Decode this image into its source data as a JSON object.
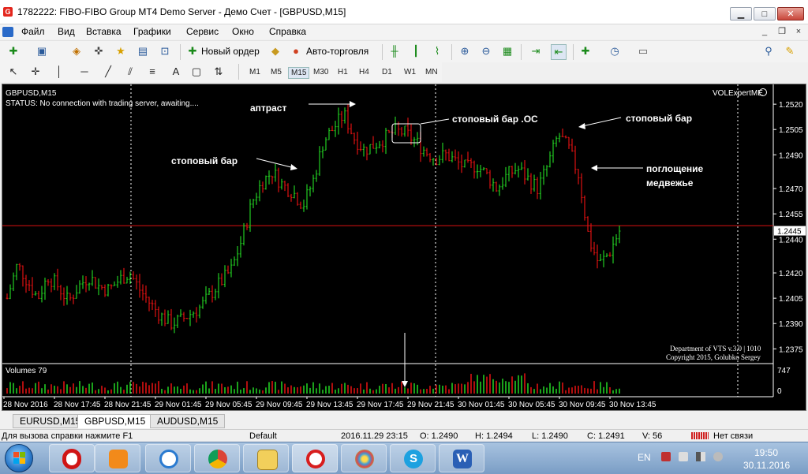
{
  "window": {
    "title": "1782222: FIBO-FIBO Group MT4 Demo Server - Демо Счет - [GBPUSD,M15]",
    "logo_letter": "G",
    "minimize": "▁",
    "maximize": "□",
    "close": "✕"
  },
  "menu": [
    "Файл",
    "Вид",
    "Вставка",
    "Графики",
    "Сервис",
    "Окно",
    "Справка"
  ],
  "toolbar": {
    "new_order": "Новый ордер",
    "auto_trading": "Авто-торговля"
  },
  "timeframes": [
    "M1",
    "M5",
    "M15",
    "M30",
    "H1",
    "H4",
    "D1",
    "W1",
    "MN"
  ],
  "active_timeframe": "M15",
  "chart": {
    "header": "GBPUSD,M15",
    "status": "STATUS:   No connection with trading server, awaiting....",
    "ea_label": "VOLExpertME",
    "copyright_line1": "Department of VTS  v.3.0 | 1010",
    "copyright_line2": "Copyright 2015, Golubko Sergey",
    "volumes_label": "Volumes 79",
    "current_price": "1.2445",
    "colors": {
      "bull": "#22cc22",
      "bear": "#dd1111",
      "background": "#000000",
      "grid": "#ffffff",
      "price_line": "#dd1111"
    },
    "annotations": [
      {
        "text": "аптраст"
      },
      {
        "text": "стоповый бар .OC"
      },
      {
        "text": "стоповый бар"
      },
      {
        "text": "стоповый бар"
      },
      {
        "text": "поглощение"
      },
      {
        "text": "медвежье"
      }
    ]
  },
  "chart_data": {
    "type": "candlestick",
    "symbol": "GBPUSD",
    "timeframe": "M15",
    "y_ticks": [
      "1.2520",
      "1.2505",
      "1.2490",
      "1.2470",
      "1.2455",
      "1.2440",
      "1.2420",
      "1.2405",
      "1.2390",
      "1.2375"
    ],
    "ylim": [
      1.237,
      1.2528
    ],
    "volume_ticks": [
      "747",
      "0"
    ],
    "x_ticks": [
      "28 Nov 2016",
      "28 Nov 17:45",
      "28 Nov 21:45",
      "29 Nov 01:45",
      "29 Nov 05:45",
      "29 Nov 09:45",
      "29 Nov 13:45",
      "29 Nov 17:45",
      "29 Nov 21:45",
      "30 Nov 01:45",
      "30 Nov 05:45",
      "30 Nov 09:45",
      "30 Nov 13:45"
    ],
    "current_price": 1.2445,
    "red_line": 1.2448,
    "closes": [
      1.2405,
      1.2425,
      1.2415,
      1.2405,
      1.2418,
      1.2412,
      1.2403,
      1.2412,
      1.2418,
      1.2412,
      1.241,
      1.2416,
      1.242,
      1.241,
      1.2402,
      1.2395,
      1.239,
      1.2392,
      1.2396,
      1.24,
      1.2408,
      1.2415,
      1.2422,
      1.244,
      1.2462,
      1.2474,
      1.248,
      1.2472,
      1.2468,
      1.246,
      1.2475,
      1.2498,
      1.2506,
      1.2514,
      1.25,
      1.2493,
      1.2496,
      1.25,
      1.2504,
      1.2503,
      1.2498,
      1.2492,
      1.2488,
      1.249,
      1.2486,
      1.2482,
      1.2484,
      1.2478,
      1.247,
      1.2478,
      1.2482,
      1.2476,
      1.247,
      1.2484,
      1.2502,
      1.2494,
      1.2478,
      1.244,
      1.2425,
      1.2432,
      1.2445
    ]
  },
  "tabs": [
    "EURUSD,M15",
    "GBPUSD,M15",
    "AUDUSD,M15"
  ],
  "active_tab": "GBPUSD,M15",
  "status": {
    "help": "Для вызова справки нажмите F1",
    "profile": "Default",
    "datetime": "2016.11.29 23:15",
    "open": "O: 1.2490",
    "high": "H: 1.2494",
    "low": "L: 1.2490",
    "close": "C: 1.2491",
    "volume": "V: 56",
    "connection": "Нет связи"
  },
  "taskbar": {
    "lang": "EN",
    "time": "19:50",
    "date": "30.11.2016",
    "apps": [
      "start",
      "opera",
      "media-player",
      "internet-explorer",
      "chrome",
      "file-explorer",
      "fibo-group",
      "paint",
      "skype",
      "word"
    ]
  }
}
